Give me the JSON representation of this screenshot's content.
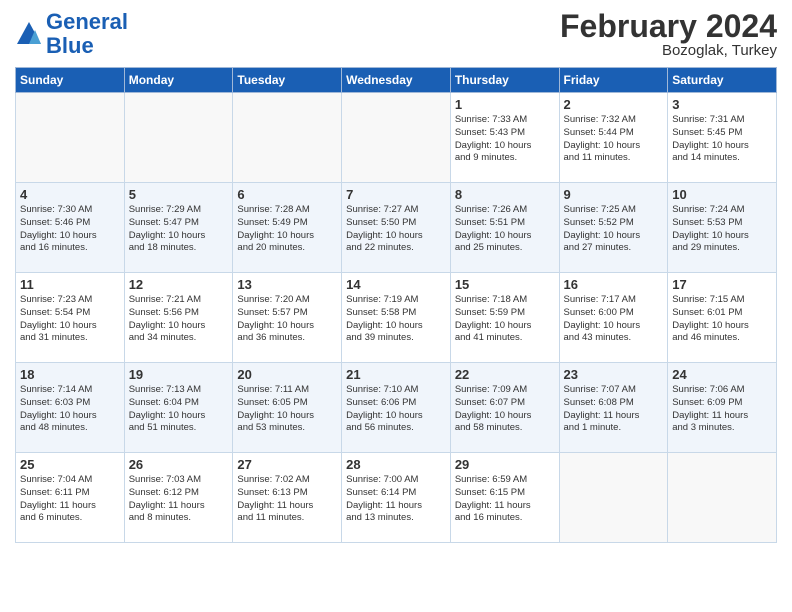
{
  "header": {
    "logo_line1": "General",
    "logo_line2": "Blue",
    "month_title": "February 2024",
    "location": "Bozoglak, Turkey"
  },
  "weekdays": [
    "Sunday",
    "Monday",
    "Tuesday",
    "Wednesday",
    "Thursday",
    "Friday",
    "Saturday"
  ],
  "weeks": [
    [
      {
        "day": "",
        "info": ""
      },
      {
        "day": "",
        "info": ""
      },
      {
        "day": "",
        "info": ""
      },
      {
        "day": "",
        "info": ""
      },
      {
        "day": "1",
        "info": "Sunrise: 7:33 AM\nSunset: 5:43 PM\nDaylight: 10 hours\nand 9 minutes."
      },
      {
        "day": "2",
        "info": "Sunrise: 7:32 AM\nSunset: 5:44 PM\nDaylight: 10 hours\nand 11 minutes."
      },
      {
        "day": "3",
        "info": "Sunrise: 7:31 AM\nSunset: 5:45 PM\nDaylight: 10 hours\nand 14 minutes."
      }
    ],
    [
      {
        "day": "4",
        "info": "Sunrise: 7:30 AM\nSunset: 5:46 PM\nDaylight: 10 hours\nand 16 minutes."
      },
      {
        "day": "5",
        "info": "Sunrise: 7:29 AM\nSunset: 5:47 PM\nDaylight: 10 hours\nand 18 minutes."
      },
      {
        "day": "6",
        "info": "Sunrise: 7:28 AM\nSunset: 5:49 PM\nDaylight: 10 hours\nand 20 minutes."
      },
      {
        "day": "7",
        "info": "Sunrise: 7:27 AM\nSunset: 5:50 PM\nDaylight: 10 hours\nand 22 minutes."
      },
      {
        "day": "8",
        "info": "Sunrise: 7:26 AM\nSunset: 5:51 PM\nDaylight: 10 hours\nand 25 minutes."
      },
      {
        "day": "9",
        "info": "Sunrise: 7:25 AM\nSunset: 5:52 PM\nDaylight: 10 hours\nand 27 minutes."
      },
      {
        "day": "10",
        "info": "Sunrise: 7:24 AM\nSunset: 5:53 PM\nDaylight: 10 hours\nand 29 minutes."
      }
    ],
    [
      {
        "day": "11",
        "info": "Sunrise: 7:23 AM\nSunset: 5:54 PM\nDaylight: 10 hours\nand 31 minutes."
      },
      {
        "day": "12",
        "info": "Sunrise: 7:21 AM\nSunset: 5:56 PM\nDaylight: 10 hours\nand 34 minutes."
      },
      {
        "day": "13",
        "info": "Sunrise: 7:20 AM\nSunset: 5:57 PM\nDaylight: 10 hours\nand 36 minutes."
      },
      {
        "day": "14",
        "info": "Sunrise: 7:19 AM\nSunset: 5:58 PM\nDaylight: 10 hours\nand 39 minutes."
      },
      {
        "day": "15",
        "info": "Sunrise: 7:18 AM\nSunset: 5:59 PM\nDaylight: 10 hours\nand 41 minutes."
      },
      {
        "day": "16",
        "info": "Sunrise: 7:17 AM\nSunset: 6:00 PM\nDaylight: 10 hours\nand 43 minutes."
      },
      {
        "day": "17",
        "info": "Sunrise: 7:15 AM\nSunset: 6:01 PM\nDaylight: 10 hours\nand 46 minutes."
      }
    ],
    [
      {
        "day": "18",
        "info": "Sunrise: 7:14 AM\nSunset: 6:03 PM\nDaylight: 10 hours\nand 48 minutes."
      },
      {
        "day": "19",
        "info": "Sunrise: 7:13 AM\nSunset: 6:04 PM\nDaylight: 10 hours\nand 51 minutes."
      },
      {
        "day": "20",
        "info": "Sunrise: 7:11 AM\nSunset: 6:05 PM\nDaylight: 10 hours\nand 53 minutes."
      },
      {
        "day": "21",
        "info": "Sunrise: 7:10 AM\nSunset: 6:06 PM\nDaylight: 10 hours\nand 56 minutes."
      },
      {
        "day": "22",
        "info": "Sunrise: 7:09 AM\nSunset: 6:07 PM\nDaylight: 10 hours\nand 58 minutes."
      },
      {
        "day": "23",
        "info": "Sunrise: 7:07 AM\nSunset: 6:08 PM\nDaylight: 11 hours\nand 1 minute."
      },
      {
        "day": "24",
        "info": "Sunrise: 7:06 AM\nSunset: 6:09 PM\nDaylight: 11 hours\nand 3 minutes."
      }
    ],
    [
      {
        "day": "25",
        "info": "Sunrise: 7:04 AM\nSunset: 6:11 PM\nDaylight: 11 hours\nand 6 minutes."
      },
      {
        "day": "26",
        "info": "Sunrise: 7:03 AM\nSunset: 6:12 PM\nDaylight: 11 hours\nand 8 minutes."
      },
      {
        "day": "27",
        "info": "Sunrise: 7:02 AM\nSunset: 6:13 PM\nDaylight: 11 hours\nand 11 minutes."
      },
      {
        "day": "28",
        "info": "Sunrise: 7:00 AM\nSunset: 6:14 PM\nDaylight: 11 hours\nand 13 minutes."
      },
      {
        "day": "29",
        "info": "Sunrise: 6:59 AM\nSunset: 6:15 PM\nDaylight: 11 hours\nand 16 minutes."
      },
      {
        "day": "",
        "info": ""
      },
      {
        "day": "",
        "info": ""
      }
    ]
  ]
}
